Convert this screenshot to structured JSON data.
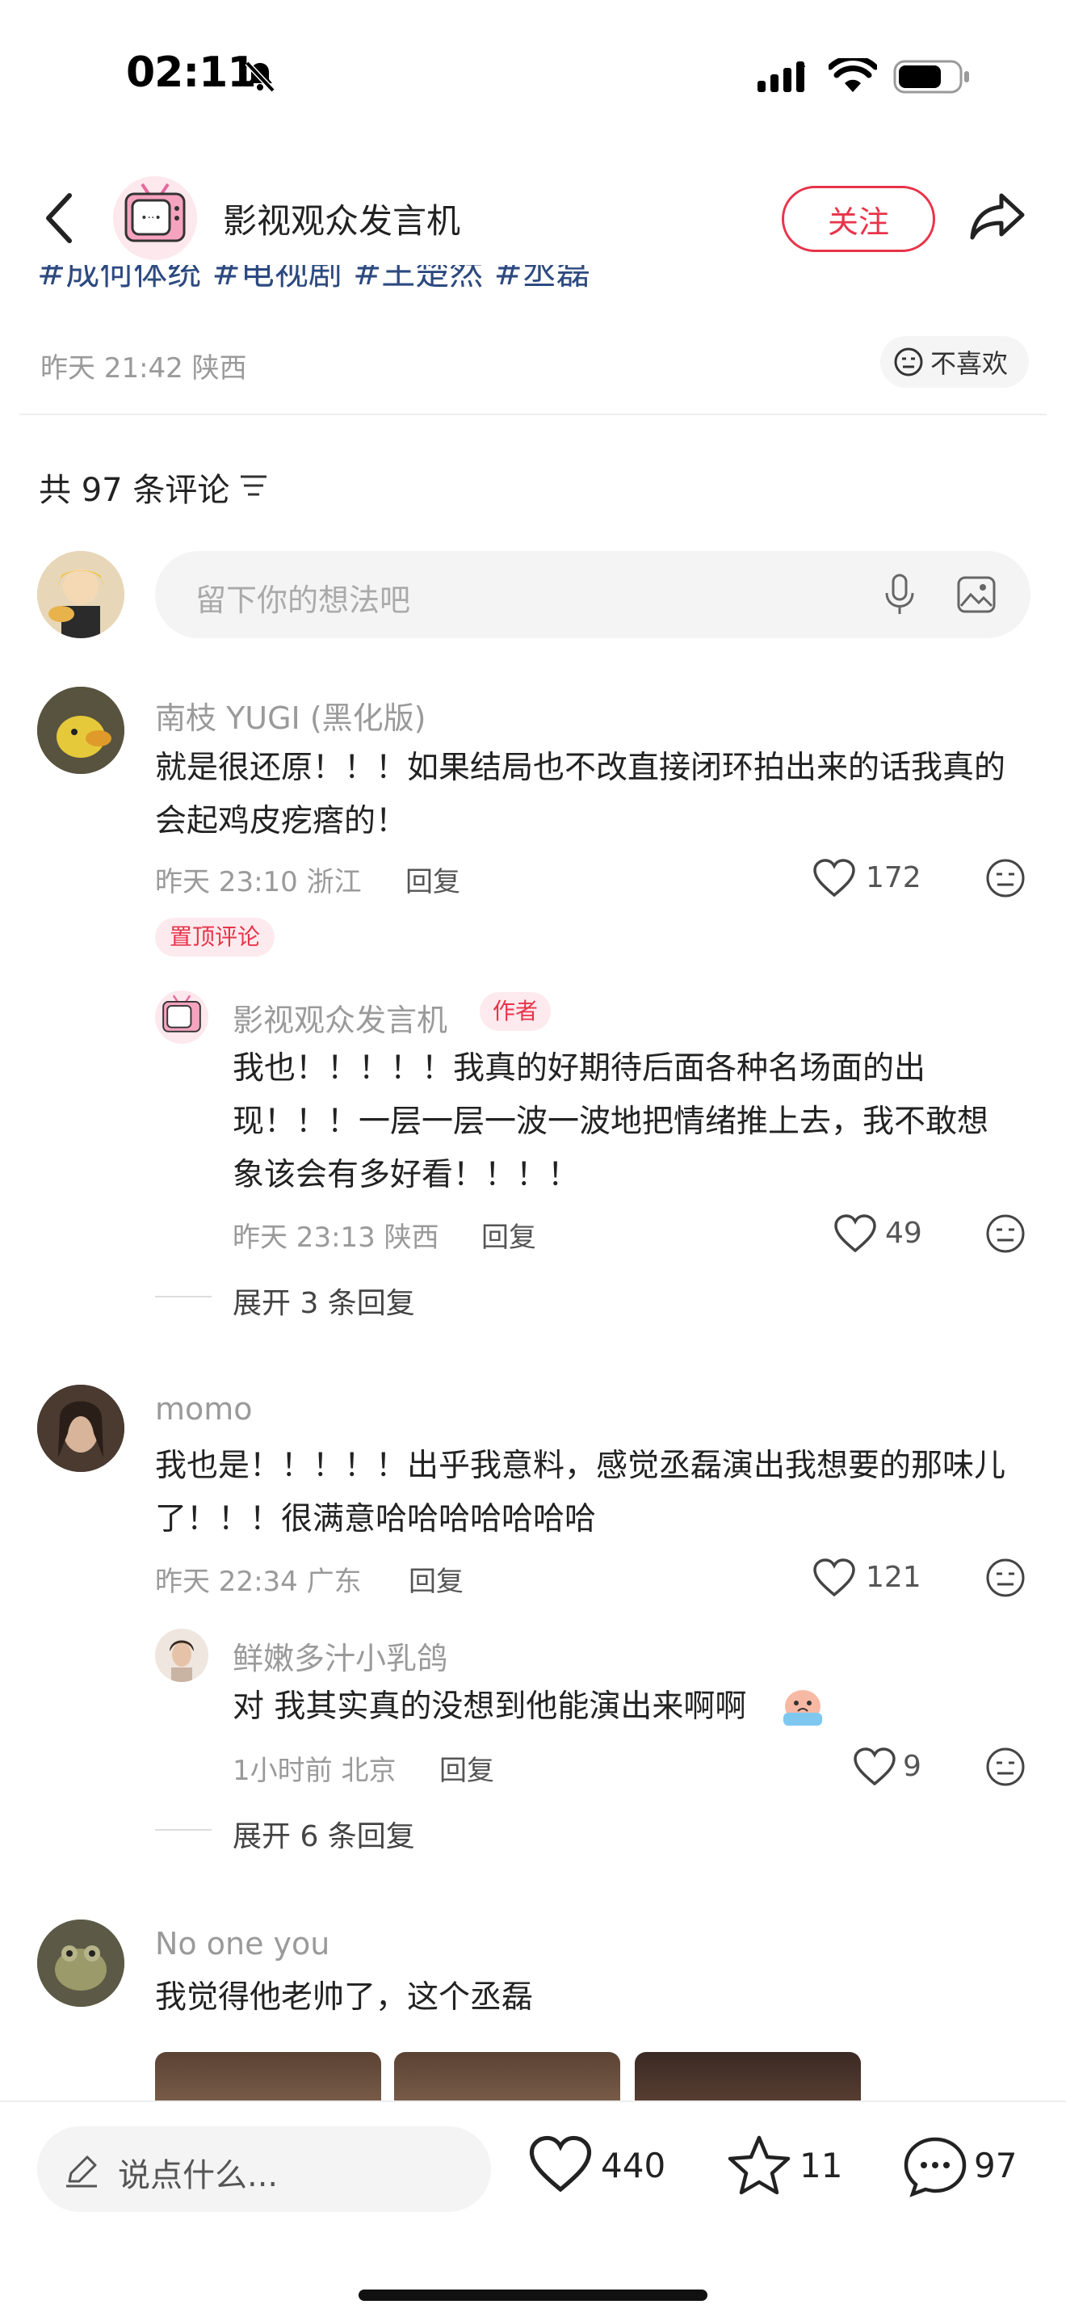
{
  "status_bar": {
    "time": "02:11"
  },
  "header": {
    "account_name": "影视观众发言机",
    "follow_label": "关注"
  },
  "post": {
    "tags": "#成何体统 #电视剧 #王楚然 #丞磊",
    "date_location": "昨天 21:42 陕西",
    "dislike_label": "不喜欢"
  },
  "comments_section": {
    "count_label": "共 97 条评论",
    "input_placeholder": "留下你的想法吧"
  },
  "comments": [
    {
      "user": "南枝 YUGI (黑化版)",
      "text": "就是很还原！！！如果结局也不改直接闭环拍出来的话我真的会起鸡皮疙瘩的！",
      "meta": "昨天 23:10 浙江",
      "reply_label": "回复",
      "likes": "172",
      "badge": "置顶评论",
      "replies": [
        {
          "user": "影视观众发言机",
          "author_tag": "作者",
          "text": "我也！！！！！我真的好期待后面各种名场面的出现！！！一层一层一波一波地把情绪推上去，我不敢想象该会有多好看！！！！",
          "meta": "昨天 23:13 陕西",
          "reply_label": "回复",
          "likes": "49"
        }
      ],
      "expand_label": "展开 3 条回复"
    },
    {
      "user": "momo",
      "text": "我也是！！！！！出乎我意料，感觉丞磊演出我想要的那味儿了！！！很满意哈哈哈哈哈哈哈",
      "meta": "昨天 22:34 广东",
      "reply_label": "回复",
      "likes": "121",
      "replies": [
        {
          "user": "鲜嫩多汁小乳鸽",
          "text": "对 我其实真的没想到他能演出来啊啊",
          "meta": "1小时前 北京",
          "reply_label": "回复",
          "likes": "9"
        }
      ],
      "expand_label": "展开 6 条回复"
    },
    {
      "user": "No one you",
      "text": "我觉得他老帅了，这个丞磊"
    }
  ],
  "bottom_bar": {
    "say_placeholder": "说点什么...",
    "likes": "440",
    "favorites": "11",
    "comments": "97"
  }
}
